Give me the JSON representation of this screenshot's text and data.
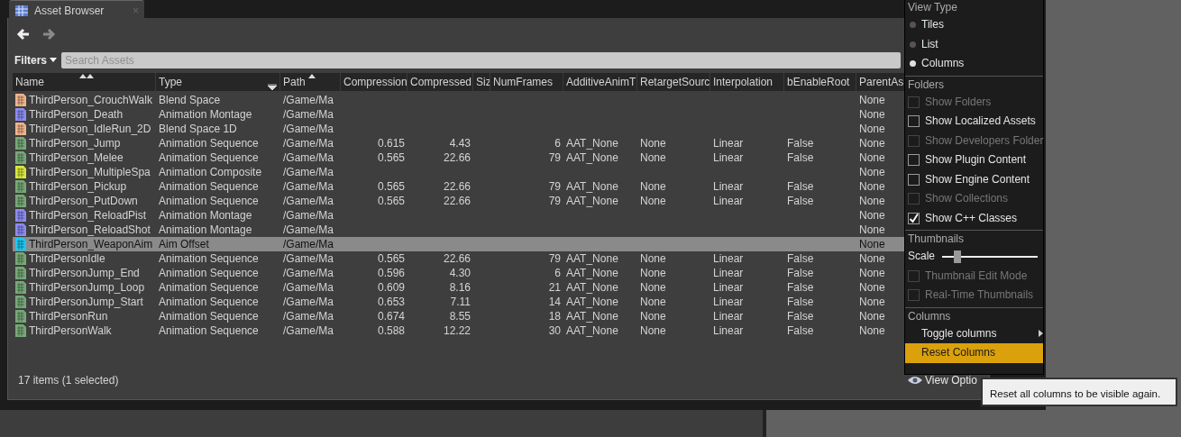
{
  "tab": {
    "title": "Asset Browser",
    "close": "×"
  },
  "nav": {
    "back_enabled": true,
    "forward_enabled": false
  },
  "filters": {
    "label": "Filters",
    "placeholder": "Search Assets"
  },
  "table": {
    "columns": [
      {
        "label": "Name",
        "primary_sort": true
      },
      {
        "label": "Type",
        "menu": true
      },
      {
        "label": "Path",
        "secondary_sort": true
      },
      {
        "label": "Compression"
      },
      {
        "label": "Compressed"
      },
      {
        "label": "Siz"
      },
      {
        "label": "NumFrames"
      },
      {
        "label": "AdditiveAnimT"
      },
      {
        "label": "RetargetSourc"
      },
      {
        "label": "Interpolation"
      },
      {
        "label": "bEnableRoot"
      },
      {
        "label": "ParentAs"
      }
    ],
    "rows": [
      {
        "name": "ThirdPerson_CrouchWalk",
        "type": "Blend Space",
        "path": "/Game/Ma",
        "parent_asset": "None",
        "color": "#f0b48c",
        "selected": false
      },
      {
        "name": "ThirdPerson_Death",
        "type": "Animation Montage",
        "path": "/Game/Ma",
        "parent_asset": "None",
        "color": "#8c8cf0",
        "selected": false
      },
      {
        "name": "ThirdPerson_IdleRun_2D",
        "type": "Blend Space 1D",
        "path": "/Game/Ma",
        "parent_asset": "None",
        "color": "#f0b48c",
        "selected": false
      },
      {
        "name": "ThirdPerson_Jump",
        "type": "Animation Sequence",
        "path": "/Game/Ma",
        "compression": "0.615",
        "compressed": "4.43",
        "num_frames": "6",
        "additive_anim_type": "AAT_None",
        "retarget_source": "None",
        "interpolation": "Linear",
        "enable_root_motion": "False",
        "parent_asset": "None",
        "color": "#78a878",
        "selected": false
      },
      {
        "name": "ThirdPerson_Melee",
        "type": "Animation Sequence",
        "path": "/Game/Ma",
        "compression": "0.565",
        "compressed": "22.66",
        "num_frames": "79",
        "additive_anim_type": "AAT_None",
        "retarget_source": "None",
        "interpolation": "Linear",
        "enable_root_motion": "False",
        "parent_asset": "None",
        "color": "#78a878",
        "selected": false
      },
      {
        "name": "ThirdPerson_MultipleSpa",
        "type": "Animation Composite",
        "path": "/Game/Ma",
        "parent_asset": "None",
        "color": "#d8e83c",
        "selected": false
      },
      {
        "name": "ThirdPerson_Pickup",
        "type": "Animation Sequence",
        "path": "/Game/Ma",
        "compression": "0.565",
        "compressed": "22.66",
        "num_frames": "79",
        "additive_anim_type": "AAT_None",
        "retarget_source": "None",
        "interpolation": "Linear",
        "enable_root_motion": "False",
        "parent_asset": "None",
        "color": "#78a878",
        "selected": false
      },
      {
        "name": "ThirdPerson_PutDown",
        "type": "Animation Sequence",
        "path": "/Game/Ma",
        "compression": "0.565",
        "compressed": "22.66",
        "num_frames": "79",
        "additive_anim_type": "AAT_None",
        "retarget_source": "None",
        "interpolation": "Linear",
        "enable_root_motion": "False",
        "parent_asset": "None",
        "color": "#78a878",
        "selected": false
      },
      {
        "name": "ThirdPerson_ReloadPist",
        "type": "Animation Montage",
        "path": "/Game/Ma",
        "parent_asset": "None",
        "color": "#8c8cf0",
        "selected": false
      },
      {
        "name": "ThirdPerson_ReloadShot",
        "type": "Animation Montage",
        "path": "/Game/Ma",
        "parent_asset": "None",
        "color": "#8c8cf0",
        "selected": false
      },
      {
        "name": "ThirdPerson_WeaponAim",
        "type": "Aim Offset",
        "path": "/Game/Ma",
        "parent_asset": "None",
        "color": "#1ec8f0",
        "selected": true
      },
      {
        "name": "ThirdPersonIdle",
        "type": "Animation Sequence",
        "path": "/Game/Ma",
        "compression": "0.565",
        "compressed": "22.66",
        "num_frames": "79",
        "additive_anim_type": "AAT_None",
        "retarget_source": "None",
        "interpolation": "Linear",
        "enable_root_motion": "False",
        "parent_asset": "None",
        "color": "#78a878",
        "selected": false
      },
      {
        "name": "ThirdPersonJump_End",
        "type": "Animation Sequence",
        "path": "/Game/Ma",
        "compression": "0.596",
        "compressed": "4.30",
        "num_frames": "6",
        "additive_anim_type": "AAT_None",
        "retarget_source": "None",
        "interpolation": "Linear",
        "enable_root_motion": "False",
        "parent_asset": "None",
        "color": "#78a878",
        "selected": false
      },
      {
        "name": "ThirdPersonJump_Loop",
        "type": "Animation Sequence",
        "path": "/Game/Ma",
        "compression": "0.609",
        "compressed": "8.16",
        "num_frames": "21",
        "additive_anim_type": "AAT_None",
        "retarget_source": "None",
        "interpolation": "Linear",
        "enable_root_motion": "False",
        "parent_asset": "None",
        "color": "#78a878",
        "selected": false
      },
      {
        "name": "ThirdPersonJump_Start",
        "type": "Animation Sequence",
        "path": "/Game/Ma",
        "compression": "0.653",
        "compressed": "7.11",
        "num_frames": "14",
        "additive_anim_type": "AAT_None",
        "retarget_source": "None",
        "interpolation": "Linear",
        "enable_root_motion": "False",
        "parent_asset": "None",
        "color": "#78a878",
        "selected": false
      },
      {
        "name": "ThirdPersonRun",
        "type": "Animation Sequence",
        "path": "/Game/Ma",
        "compression": "0.674",
        "compressed": "8.55",
        "num_frames": "18",
        "additive_anim_type": "AAT_None",
        "retarget_source": "None",
        "interpolation": "Linear",
        "enable_root_motion": "False",
        "parent_asset": "None",
        "color": "#78a878",
        "selected": false
      },
      {
        "name": "ThirdPersonWalk",
        "type": "Animation Sequence",
        "path": "/Game/Ma",
        "compression": "0.588",
        "compressed": "12.22",
        "num_frames": "30",
        "additive_anim_type": "AAT_None",
        "retarget_source": "None",
        "interpolation": "Linear",
        "enable_root_motion": "False",
        "parent_asset": "None",
        "color": "#78a878",
        "selected": false
      }
    ]
  },
  "status_bar": "17 items (1 selected)",
  "view_options": "View Optio",
  "view_menu": {
    "sections": [
      {
        "heading": "View Type",
        "items": [
          {
            "kind": "radio",
            "label": "Tiles",
            "selected": false
          },
          {
            "kind": "radio",
            "label": "List",
            "selected": false
          },
          {
            "kind": "radio",
            "label": "Columns",
            "selected": true
          }
        ]
      },
      {
        "heading": "Folders",
        "items": [
          {
            "kind": "checkbox",
            "label": "Show Folders",
            "checked": false,
            "disabled": true
          },
          {
            "kind": "checkbox",
            "label": "Show Localized Assets",
            "checked": false,
            "disabled": false
          },
          {
            "kind": "checkbox",
            "label": "Show Developers Folder",
            "checked": false,
            "disabled": true
          },
          {
            "kind": "checkbox",
            "label": "Show Plugin Content",
            "checked": false,
            "disabled": false
          },
          {
            "kind": "checkbox",
            "label": "Show Engine Content",
            "checked": false,
            "disabled": false
          },
          {
            "kind": "checkbox",
            "label": "Show Collections",
            "checked": false,
            "disabled": true
          },
          {
            "kind": "checkbox",
            "label": "Show C++ Classes",
            "checked": true,
            "disabled": false
          }
        ]
      },
      {
        "heading": "Thumbnails",
        "items": [
          {
            "kind": "slider",
            "label": "Scale",
            "level": 0.13
          },
          {
            "kind": "checkbox",
            "label": "Thumbnail Edit Mode",
            "checked": false,
            "disabled": true
          },
          {
            "kind": "checkbox",
            "label": "Real-Time Thumbnails",
            "checked": false,
            "disabled": true
          }
        ]
      },
      {
        "heading": "Columns",
        "items": [
          {
            "kind": "submenu",
            "label": "Toggle columns"
          },
          {
            "kind": "action",
            "label": "Reset Columns",
            "highlighted": true
          }
        ]
      }
    ]
  },
  "tooltip": "Reset all columns to be visible again."
}
